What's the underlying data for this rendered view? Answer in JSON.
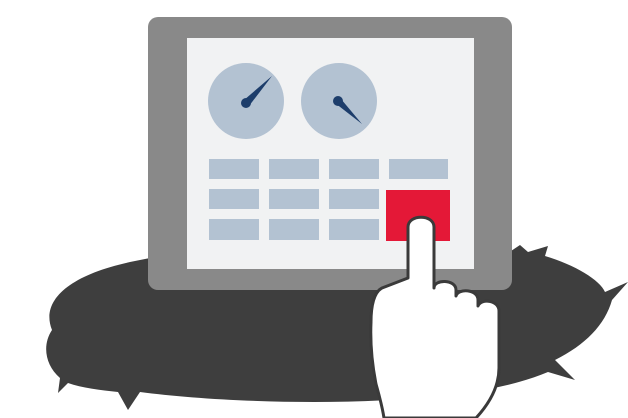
{
  "illustration": {
    "subject": "tablet-touch-control-panel",
    "icons": [
      "pressure-gauge-icon",
      "pressure-gauge-icon",
      "pointing-hand-icon"
    ],
    "gauges": [
      {
        "needle_direction": "up-right"
      },
      {
        "needle_direction": "down-right"
      }
    ],
    "keypad": {
      "rows": 3,
      "columns": 4,
      "highlighted_key": {
        "row": 3,
        "column": 4
      }
    }
  },
  "colors": {
    "background": "#ffffff",
    "shadow": "#3e3e3e",
    "tablet_frame": "#898989",
    "screen": "#f1f2f3",
    "gauge_face": "#b3c2d2",
    "needle": "#1d3d6b",
    "key": "#b3c2d2",
    "key_highlight": "#e41837",
    "hand_fill": "#ffffff",
    "hand_outline": "#3a3a3a"
  }
}
